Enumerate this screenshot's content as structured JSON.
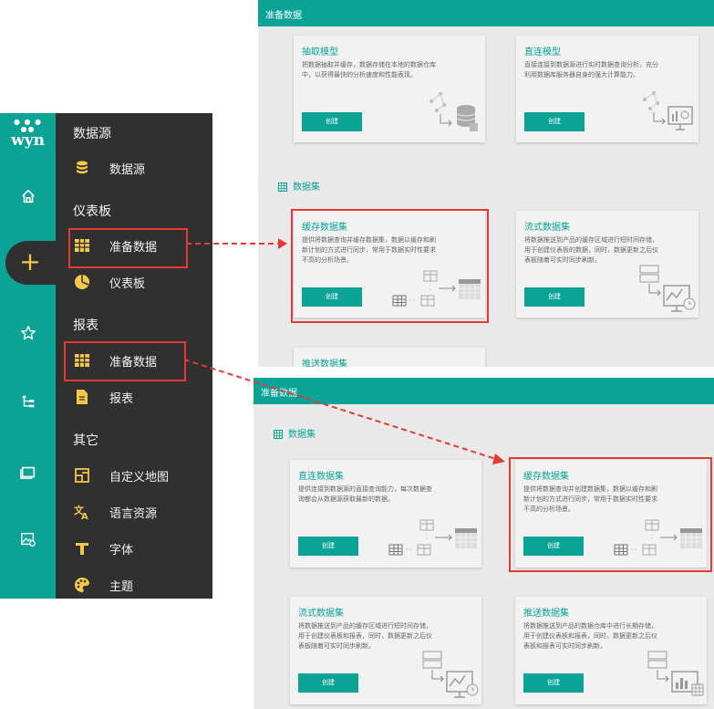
{
  "nav": {
    "logo_text": "wyn",
    "rail_icons": [
      "home-icon",
      "plus-icon",
      "star-icon",
      "tree-icon",
      "folder-icon",
      "image-settings-icon"
    ],
    "sections": [
      {
        "title": "数据源",
        "items": [
          {
            "label": "数据源",
            "icon": "database-icon"
          }
        ]
      },
      {
        "title": "仪表板",
        "items": [
          {
            "label": "准备数据",
            "icon": "grid-icon"
          },
          {
            "label": "仪表板",
            "icon": "pie-icon"
          }
        ]
      },
      {
        "title": "报表",
        "items": [
          {
            "label": "准备数据",
            "icon": "grid-icon"
          },
          {
            "label": "报表",
            "icon": "document-icon"
          }
        ]
      },
      {
        "title": "其它",
        "items": [
          {
            "label": "自定义地图",
            "icon": "map-icon"
          },
          {
            "label": "语言资源",
            "icon": "translate-icon"
          },
          {
            "label": "字体",
            "icon": "font-icon"
          },
          {
            "label": "主题",
            "icon": "palette-icon"
          }
        ]
      }
    ]
  },
  "panel_top": {
    "title": "准备数据",
    "models": [
      {
        "title": "抽取模型",
        "desc": "把数据抽取并缓存，数据存储在本地的数据仓库中，以获得最快的分析速度和性能表现。",
        "button": "创建"
      },
      {
        "title": "直连模型",
        "desc": "直接连接到数据源进行实时数据查询分析，充分利用数据库服务器自身的强大计算能力。",
        "button": "创建"
      }
    ],
    "dataset_section": "数据集",
    "datasets": [
      {
        "title": "缓存数据集",
        "desc": "提供将数据查询并缓存数据集，数据以缓存和刷新计划的方式进行同步，常用于数据实时性要求不高的分析场景。",
        "button": "创建"
      },
      {
        "title": "流式数据集",
        "desc": "将数据推送到产品的缓存区域进行短时间存储，用于创建仪表板的数据，同时，数据更新之后仪表板随着可实时同步刷新。",
        "button": "创建"
      },
      {
        "title": "推送数据集"
      }
    ]
  },
  "panel_bottom": {
    "title": "准备数据",
    "dataset_section": "数据集",
    "datasets": [
      {
        "title": "直连数据集",
        "desc": "提供连接到数据源的直接查询能力，每次数据查询都会从数据源获取最新的数据。",
        "button": "创建"
      },
      {
        "title": "缓存数据集",
        "desc": "提供将数据查询并创建数据集，数据以缓存和刷新计划的方式进行同步，常用于数据实时性要求不高的分析场景。",
        "button": "创建"
      },
      {
        "title": "流式数据集",
        "desc": "将数据推送到产品的缓存区域进行短时间存储，用于创建仪表板和报表，同时，数据更新之后仪表板随着可实时同步刷新。",
        "button": "创建"
      },
      {
        "title": "推送数据集",
        "desc": "将数据推送到产品的数据仓库中进行长期存储，用于创建仪表板和报表，同时，数据更新之后仪表板和报表可实时同步刷新。",
        "button": "创建"
      }
    ]
  },
  "colors": {
    "accent": "#0aa396",
    "sidebar": "#303030",
    "highlight": "#e53935",
    "menu_icon": "#f5c84a"
  }
}
